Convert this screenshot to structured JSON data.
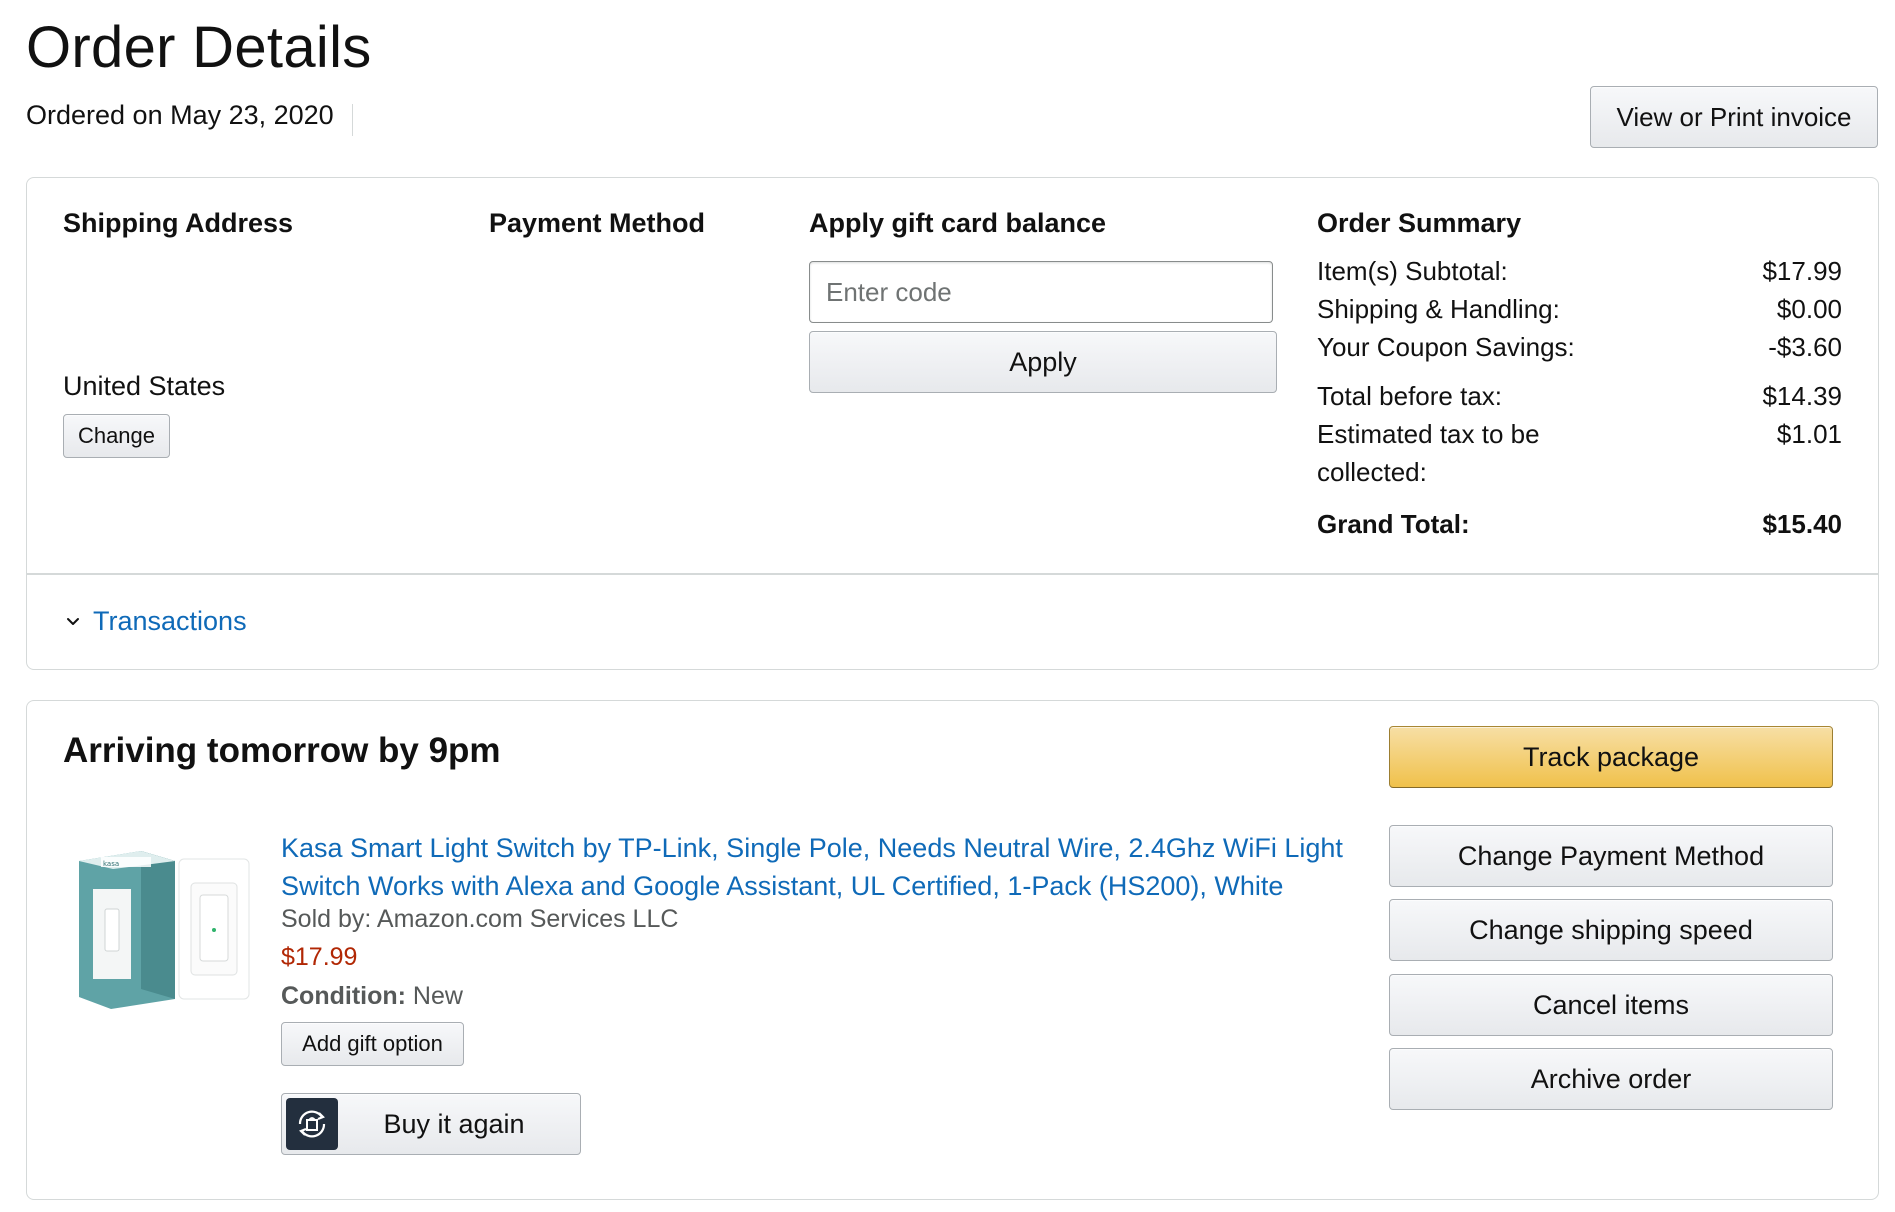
{
  "header": {
    "title": "Order Details",
    "ordered_on": "Ordered on May 23, 2020",
    "invoice_button": "View or Print invoice"
  },
  "shipping": {
    "heading": "Shipping Address",
    "country": "United States",
    "change_button": "Change"
  },
  "payment": {
    "heading": "Payment Method"
  },
  "gift_card": {
    "heading": "Apply gift card balance",
    "input_placeholder": "Enter code",
    "input_value": "",
    "apply_button": "Apply"
  },
  "summary": {
    "heading": "Order Summary",
    "rows": [
      {
        "label": "Item(s) Subtotal:",
        "value": "$17.99"
      },
      {
        "label": "Shipping & Handling:",
        "value": "$0.00"
      },
      {
        "label": "Your Coupon Savings:",
        "value": "-$3.60"
      },
      {
        "label": "Total before tax:",
        "value": "$14.39"
      },
      {
        "label": "Estimated tax to be collected:",
        "value": "$1.01"
      }
    ],
    "grand_total_label": "Grand Total:",
    "grand_total_value": "$15.40"
  },
  "transactions": {
    "label": "Transactions",
    "icon": "chevron-down-icon"
  },
  "shipment": {
    "heading": "Arriving tomorrow by 9pm",
    "product": {
      "title": "Kasa Smart Light Switch by TP-Link, Single Pole, Needs Neutral Wire, 2.4Ghz WiFi Light Switch Works with Alexa and Google Assistant, UL Certified, 1-Pack (HS200), White",
      "sold_by": "Sold by: Amazon.com Services LLC",
      "price": "$17.99",
      "condition_label": "Condition:",
      "condition_value": "New",
      "gift_option_button": "Add gift option",
      "buy_again_button": "Buy it again",
      "image_label": "kasa"
    },
    "actions": {
      "track_package": "Track package",
      "change_payment": "Change Payment Method",
      "change_shipping_speed": "Change shipping speed",
      "cancel_items": "Cancel items",
      "archive_order": "Archive order"
    }
  },
  "colors": {
    "link": "#0f6ab8",
    "price": "#b12704",
    "track_button": "#f0c14b",
    "buy_again_icon_bg": "#232f3e"
  }
}
